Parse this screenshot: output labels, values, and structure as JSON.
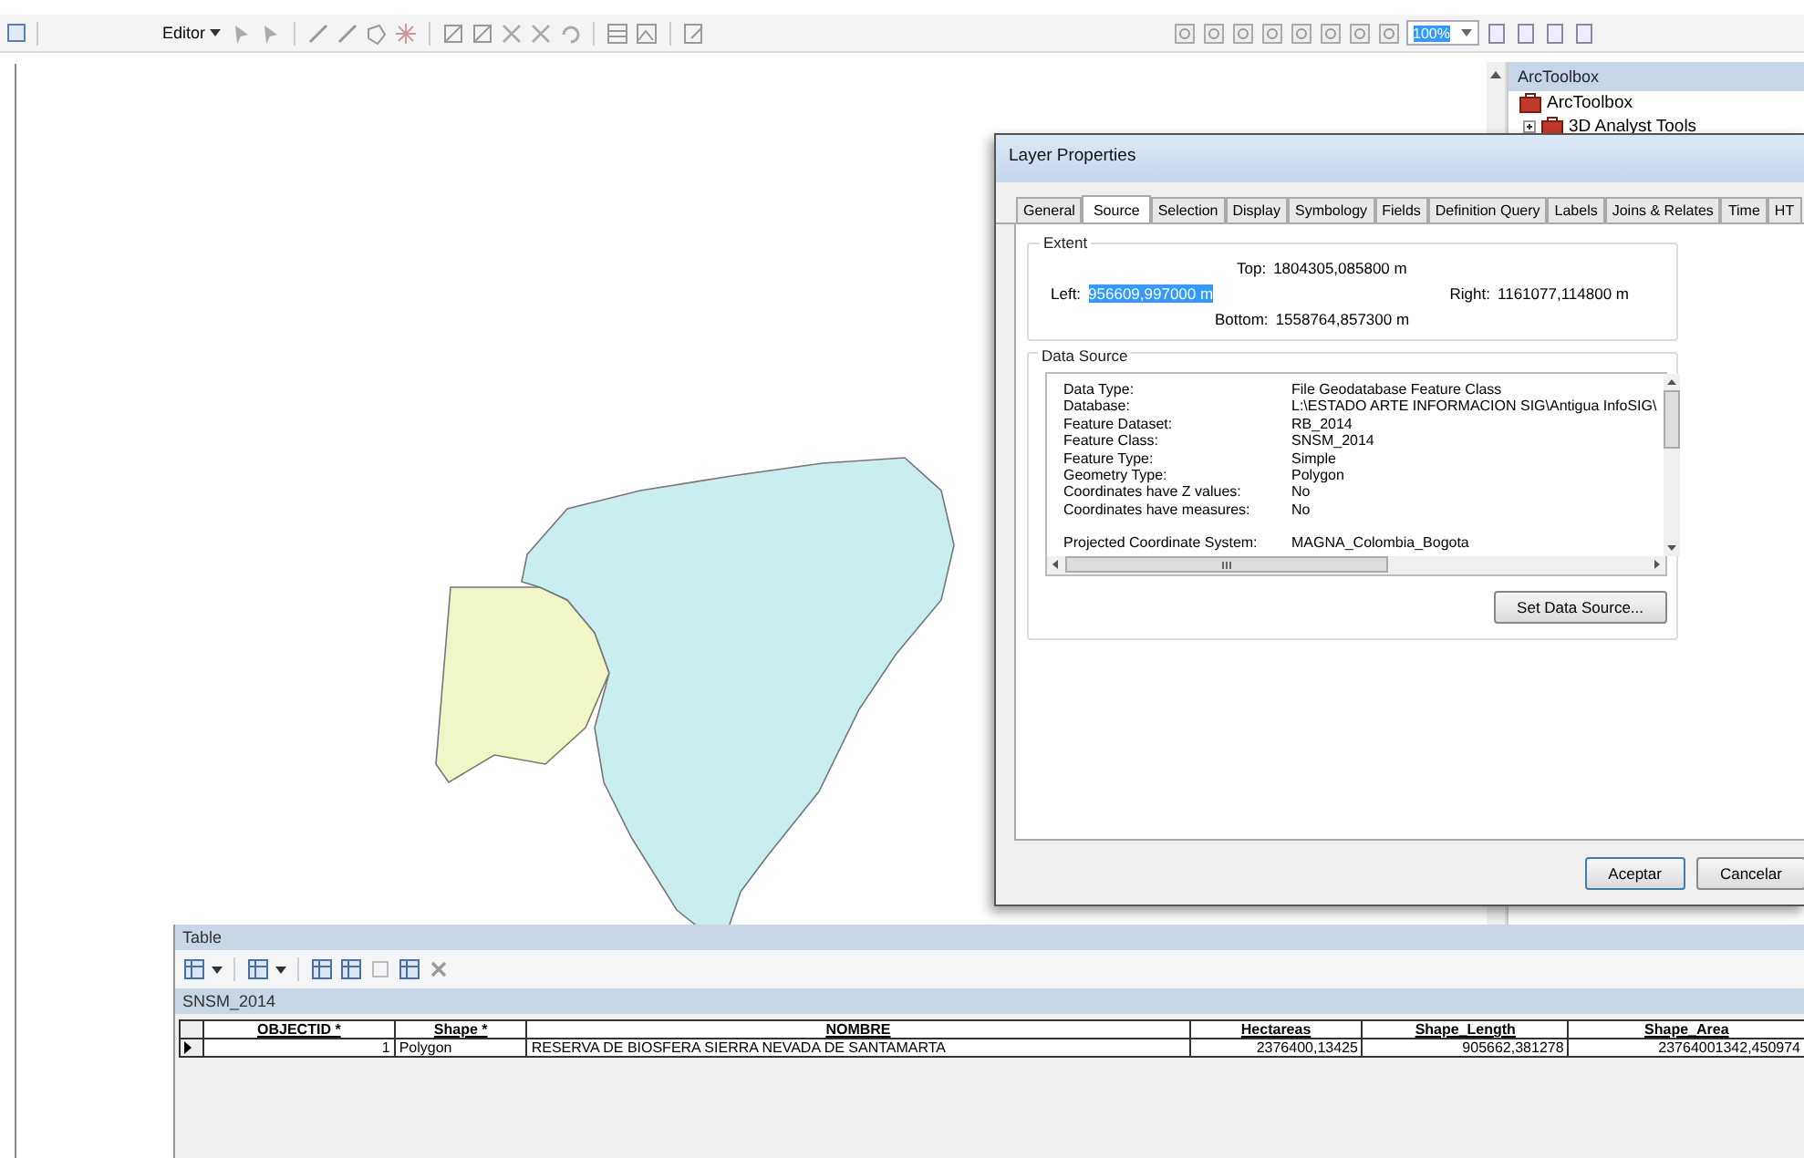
{
  "toolbar": {
    "editor_menu": "Editor",
    "zoom_field": "100%"
  },
  "arctoolbox": {
    "title": "ArcToolbox",
    "items": [
      {
        "label": "ArcToolbox",
        "kind": "root"
      },
      {
        "label": "3D Analyst Tools",
        "kind": "toolbox"
      }
    ]
  },
  "dialog": {
    "title": "Layer Properties",
    "tabs": [
      {
        "label": "General",
        "selected": false
      },
      {
        "label": "Source",
        "selected": true
      },
      {
        "label": "Selection",
        "selected": false
      },
      {
        "label": "Display",
        "selected": false
      },
      {
        "label": "Symbology",
        "selected": false
      },
      {
        "label": "Fields",
        "selected": false
      },
      {
        "label": "Definition Query",
        "selected": false
      },
      {
        "label": "Labels",
        "selected": false
      },
      {
        "label": "Joins & Relates",
        "selected": false
      },
      {
        "label": "Time",
        "selected": false
      },
      {
        "label": "HT",
        "selected": false
      }
    ],
    "extent": {
      "legend": "Extent",
      "top_label": "Top:",
      "top": "1804305,085800 m",
      "left_label": "Left:",
      "left": "956609,997000 m",
      "left_selected": true,
      "right_label": "Right:",
      "right": "1161077,114800 m",
      "bottom_label": "Bottom:",
      "bottom": "1558764,857300 m"
    },
    "data_source": {
      "legend": "Data Source",
      "rows": [
        {
          "label": "Data Type:",
          "value": "File Geodatabase Feature Class",
          "kind": "plain"
        },
        {
          "label": "Database:",
          "value": "L:\\ESTADO ARTE INFORMACION SIG\\Antigua InfoSIG\\",
          "kind": "plain"
        },
        {
          "label": "Feature Dataset:",
          "value": "RB_2014",
          "kind": "plain"
        },
        {
          "label": "Feature Class:",
          "value": "SNSM_2014",
          "kind": "plain"
        },
        {
          "label": "Feature Type:",
          "value": "Simple",
          "kind": "plain"
        },
        {
          "label": "Geometry Type:",
          "value": "Polygon",
          "kind": "plain"
        },
        {
          "label": "Coordinates have Z values:",
          "value": "No",
          "kind": "plain"
        },
        {
          "label": "Coordinates have measures:",
          "value": "No",
          "kind": "plain"
        },
        {
          "label": "Projected Coordinate System:",
          "value": "MAGNA_Colombia_Bogota",
          "kind": "spaced"
        }
      ],
      "button": "Set Data Source..."
    },
    "buttons": [
      "Aceptar",
      "Cancelar"
    ]
  },
  "table": {
    "title": "Table",
    "tab": "SNSM_2014",
    "columns": [
      {
        "label": "OBJECTID *"
      },
      {
        "label": "Shape *"
      },
      {
        "label": "NOMBRE"
      },
      {
        "label": "Hectareas"
      },
      {
        "label": "Shape_Length"
      },
      {
        "label": "Shape_Area"
      }
    ],
    "rows": [
      {
        "current": true,
        "cells": [
          "1",
          "Polygon",
          "RESERVA DE BIOSFERA SIERRA NEVADA DE SANTAMARTA",
          "2376400,13425",
          "905662,381278",
          "23764001342,450974"
        ]
      }
    ]
  }
}
